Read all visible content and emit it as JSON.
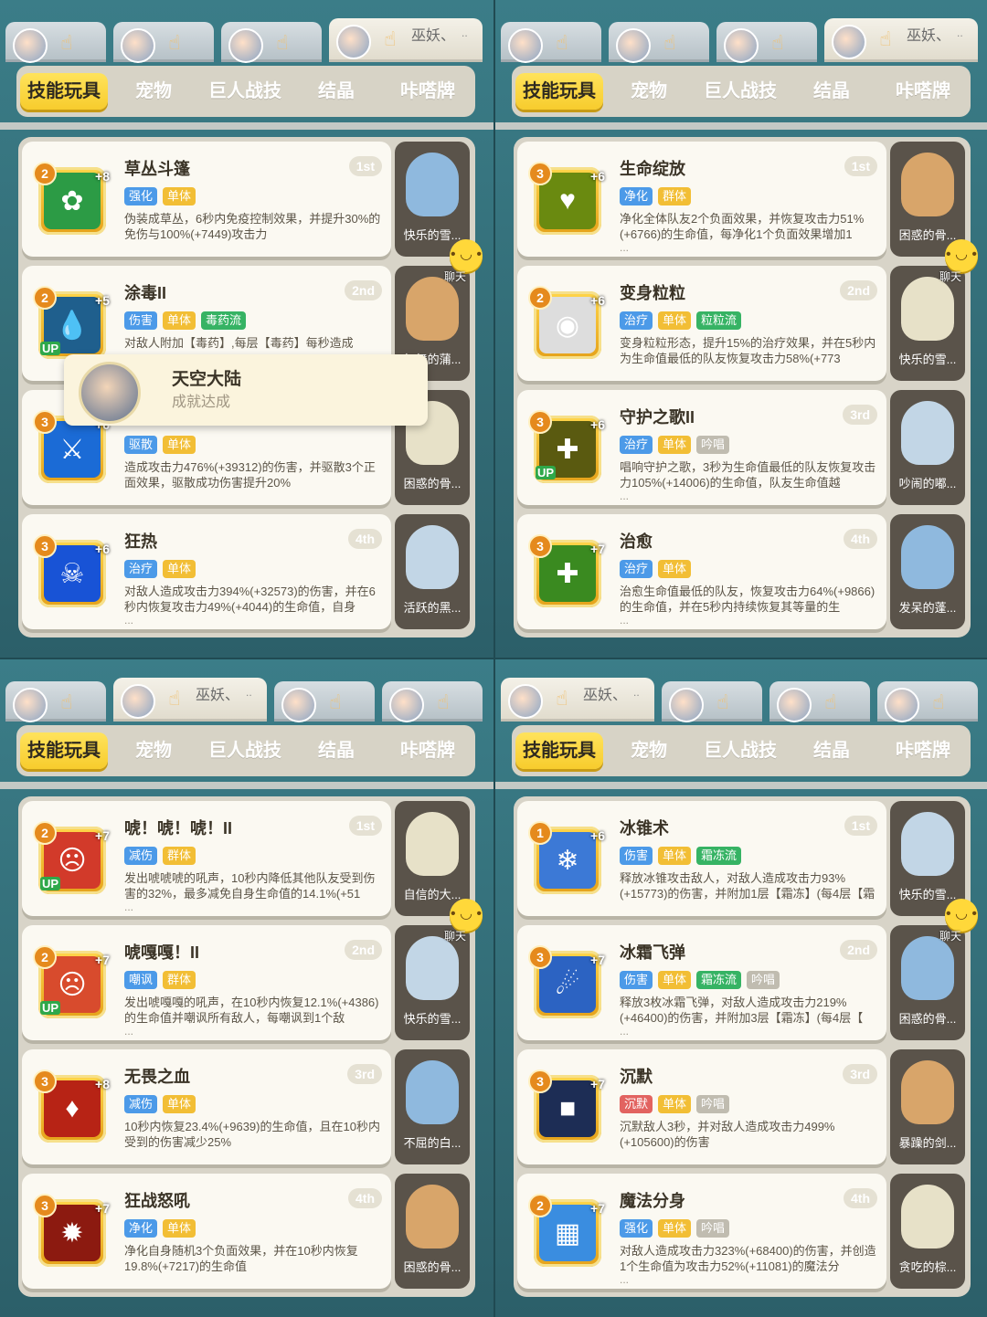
{
  "tabs": [
    "技能玩具",
    "宠物",
    "巨人战技",
    "结晶",
    "咔嗒牌"
  ],
  "chat_label": "聊天",
  "toast": {
    "title": "天空大陆",
    "subtitle": "成就达成"
  },
  "panels": [
    {
      "slot_name": "巫妖、",
      "slot_dots": "..",
      "cards": [
        {
          "title": "草丛斗篷",
          "rank": "1st",
          "level": "2",
          "plus": "+8",
          "up": "",
          "tags": [
            "强化",
            "单体"
          ],
          "desc": "伪装成草丛，6秒内免疫控制效果，并提升30%的免伤与100%(+7449)攻击力",
          "ellipsis": "",
          "pet": "快乐的雪..."
        },
        {
          "title": "涂毒II",
          "rank": "2nd",
          "level": "2",
          "plus": "+5",
          "up": "UP",
          "tags": [
            "伤害",
            "单体",
            "毒药流"
          ],
          "desc": "对敌人附加【毒药】,每层【毒药】每秒造成",
          "ellipsis": "...",
          "pet": "舞舞的蒲..."
        },
        {
          "title": "",
          "rank": "",
          "level": "3",
          "plus": "+6",
          "up": "",
          "tags": [
            "驱散",
            "单体"
          ],
          "desc": "造成攻击力476%(+39312)的伤害，并驱散3个正面效果，驱散成功伤害提升20%",
          "ellipsis": "",
          "pet": "困惑的骨..."
        },
        {
          "title": "狂热",
          "rank": "4th",
          "level": "3",
          "plus": "+6",
          "up": "",
          "tags": [
            "治疗",
            "单体"
          ],
          "desc": "对敌人造成攻击力394%(+32573)的伤害，并在6秒内恢复攻击力49%(+4044)的生命值，自身",
          "ellipsis": "...",
          "pet": "活跃的黑..."
        }
      ]
    },
    {
      "slot_name": "巫妖、",
      "slot_dots": "..",
      "cards": [
        {
          "title": "生命绽放",
          "rank": "1st",
          "level": "3",
          "plus": "+6",
          "up": "",
          "tags": [
            "净化",
            "群体"
          ],
          "desc": "净化全体队友2个负面效果，并恢复攻击力51%(+6766)的生命值，每净化1个负面效果增加1",
          "ellipsis": "...",
          "pet": "困惑的骨..."
        },
        {
          "title": "变身粒粒",
          "rank": "2nd",
          "level": "2",
          "plus": "+6",
          "up": "",
          "tags": [
            "治疗",
            "单体",
            "粒粒流"
          ],
          "desc": "变身粒粒形态，提升15%的治疗效果，并在5秒内为生命值最低的队友恢复攻击力58%(+773",
          "ellipsis": "",
          "pet": "快乐的雪..."
        },
        {
          "title": "守护之歌II",
          "rank": "3rd",
          "level": "3",
          "plus": "+6",
          "up": "UP",
          "tags": [
            "治疗",
            "单体",
            "吟唱"
          ],
          "desc": "唱响守护之歌，3秒为生命值最低的队友恢复攻击力105%(+14006)的生命值，队友生命值越",
          "ellipsis": "...",
          "pet": "吵闹的嘟..."
        },
        {
          "title": "治愈",
          "rank": "4th",
          "level": "3",
          "plus": "+7",
          "up": "",
          "tags": [
            "治疗",
            "单体"
          ],
          "desc": "治愈生命值最低的队友，恢复攻击力64%(+9866)的生命值，并在5秒内持续恢复其等量的生",
          "ellipsis": "...",
          "pet": "发呆的蓬..."
        }
      ]
    },
    {
      "slot_name": "巫妖、",
      "slot_dots": "..",
      "cards": [
        {
          "title": "唬！唬！唬！II",
          "rank": "1st",
          "level": "2",
          "plus": "+7",
          "up": "UP",
          "tags": [
            "减伤",
            "群体"
          ],
          "desc": "发出唬唬唬的吼声，10秒内降低其他队友受到伤害的32%，最多减免自身生命值的14.1%(+51",
          "ellipsis": "...",
          "pet": "自信的大..."
        },
        {
          "title": "唬嘎嘎！II",
          "rank": "2nd",
          "level": "2",
          "plus": "+7",
          "up": "UP",
          "tags": [
            "嘲讽",
            "群体"
          ],
          "desc": "发出唬嘎嘎的吼声，在10秒内恢复12.1%(+4386)的生命值并嘲讽所有敌人，每嘲讽到1个敌",
          "ellipsis": "...",
          "pet": "快乐的雪..."
        },
        {
          "title": "无畏之血",
          "rank": "3rd",
          "level": "3",
          "plus": "+8",
          "up": "",
          "tags": [
            "减伤",
            "单体"
          ],
          "desc": "10秒内恢复23.4%(+9639)的生命值，且在10秒内受到的伤害减少25%",
          "ellipsis": "",
          "pet": "不屈的白..."
        },
        {
          "title": "狂战怒吼",
          "rank": "4th",
          "level": "3",
          "plus": "+7",
          "up": "",
          "tags": [
            "净化",
            "单体"
          ],
          "desc": "净化自身随机3个负面效果，并在10秒内恢复19.8%(+7217)的生命值",
          "ellipsis": "",
          "pet": "困惑的骨..."
        }
      ]
    },
    {
      "slot_name": "巫妖、",
      "slot_dots": "..",
      "cards": [
        {
          "title": "冰锥术",
          "rank": "1st",
          "level": "1",
          "plus": "+6",
          "up": "",
          "tags": [
            "伤害",
            "单体",
            "霜冻流"
          ],
          "desc": "释放冰锥攻击敌人，对敌人造成攻击力93%(+15773)的伤害，并附加1层【霜冻】(每4层【霜",
          "ellipsis": "",
          "pet": "快乐的雪..."
        },
        {
          "title": "冰霜飞弹",
          "rank": "2nd",
          "level": "3",
          "plus": "+7",
          "up": "",
          "tags": [
            "伤害",
            "单体",
            "霜冻流",
            "吟唱"
          ],
          "desc": "释放3枚冰霜飞弹，对敌人造成攻击力219%(+46400)的伤害，并附加3层【霜冻】(每4层【",
          "ellipsis": "...",
          "pet": "困惑的骨..."
        },
        {
          "title": "沉默",
          "rank": "3rd",
          "level": "3",
          "plus": "+7",
          "up": "",
          "tags": [
            "沉默",
            "单体",
            "吟唱"
          ],
          "desc": "沉默敌人3秒，并对敌人造成攻击力499%(+105600)的伤害",
          "ellipsis": "",
          "pet": "暴躁的剑..."
        },
        {
          "title": "魔法分身",
          "rank": "4th",
          "level": "2",
          "plus": "+7",
          "up": "",
          "tags": [
            "强化",
            "单体",
            "吟唱"
          ],
          "desc": "对敌人造成攻击力323%(+68400)的伤害，并创造1个生命值为攻击力52%(+11081)的魔法分",
          "ellipsis": "...",
          "pet": "贪吃的棕..."
        }
      ]
    }
  ],
  "colors": {
    "tab_active": "#f7cc2d",
    "tag_blue": "#4c9ae8",
    "tag_yellow": "#f2be35",
    "tag_green": "#36b364",
    "tag_grey": "#c0bcb0",
    "tag_red": "#e26360"
  }
}
